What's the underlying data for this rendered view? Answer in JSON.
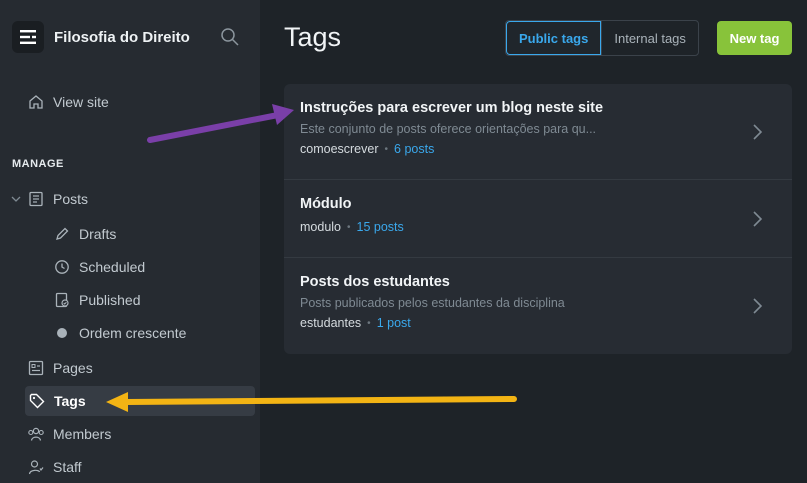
{
  "brand": {
    "title": "Filosofia do Direito"
  },
  "sidebar": {
    "view_site": "View site",
    "section_manage": "MANAGE",
    "posts": "Posts",
    "drafts": "Drafts",
    "scheduled": "Scheduled",
    "published": "Published",
    "ordem": "Ordem crescente",
    "pages": "Pages",
    "tags": "Tags",
    "members": "Members",
    "staff": "Staff"
  },
  "main": {
    "title": "Tags",
    "seg_public": "Public tags",
    "seg_internal": "Internal tags",
    "new_tag": "New tag"
  },
  "tags": [
    {
      "name": "Instruções para escrever um blog neste site",
      "description": "Este conjunto de posts oferece orientações para qu...",
      "slug": "comoescrever",
      "count": "6 posts"
    },
    {
      "name": "Módulo",
      "description": "",
      "slug": "modulo",
      "count": "15 posts"
    },
    {
      "name": "Posts dos estudantes",
      "description": "Posts publicados pelos estudantes da disciplina",
      "slug": "estudantes",
      "count": "1 post"
    }
  ],
  "colors": {
    "accent": "#3aa8ec",
    "primary_button": "#88c33a",
    "arrow_purple": "#7a3fa8",
    "arrow_yellow": "#f3b414"
  }
}
